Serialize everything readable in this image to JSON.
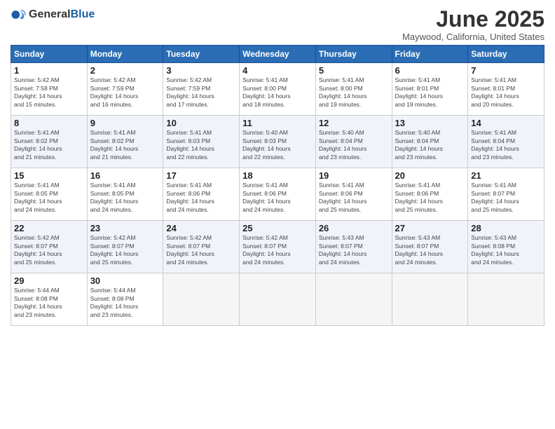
{
  "logo": {
    "general": "General",
    "blue": "Blue"
  },
  "title": "June 2025",
  "location": "Maywood, California, United States",
  "days_header": [
    "Sunday",
    "Monday",
    "Tuesday",
    "Wednesday",
    "Thursday",
    "Friday",
    "Saturday"
  ],
  "weeks": [
    [
      {
        "day": "1",
        "info": "Sunrise: 5:42 AM\nSunset: 7:58 PM\nDaylight: 14 hours\nand 15 minutes."
      },
      {
        "day": "2",
        "info": "Sunrise: 5:42 AM\nSunset: 7:59 PM\nDaylight: 14 hours\nand 16 minutes."
      },
      {
        "day": "3",
        "info": "Sunrise: 5:42 AM\nSunset: 7:59 PM\nDaylight: 14 hours\nand 17 minutes."
      },
      {
        "day": "4",
        "info": "Sunrise: 5:41 AM\nSunset: 8:00 PM\nDaylight: 14 hours\nand 18 minutes."
      },
      {
        "day": "5",
        "info": "Sunrise: 5:41 AM\nSunset: 8:00 PM\nDaylight: 14 hours\nand 19 minutes."
      },
      {
        "day": "6",
        "info": "Sunrise: 5:41 AM\nSunset: 8:01 PM\nDaylight: 14 hours\nand 19 minutes."
      },
      {
        "day": "7",
        "info": "Sunrise: 5:41 AM\nSunset: 8:01 PM\nDaylight: 14 hours\nand 20 minutes."
      }
    ],
    [
      {
        "day": "8",
        "info": "Sunrise: 5:41 AM\nSunset: 8:02 PM\nDaylight: 14 hours\nand 21 minutes."
      },
      {
        "day": "9",
        "info": "Sunrise: 5:41 AM\nSunset: 8:02 PM\nDaylight: 14 hours\nand 21 minutes."
      },
      {
        "day": "10",
        "info": "Sunrise: 5:41 AM\nSunset: 8:03 PM\nDaylight: 14 hours\nand 22 minutes."
      },
      {
        "day": "11",
        "info": "Sunrise: 5:40 AM\nSunset: 8:03 PM\nDaylight: 14 hours\nand 22 minutes."
      },
      {
        "day": "12",
        "info": "Sunrise: 5:40 AM\nSunset: 8:04 PM\nDaylight: 14 hours\nand 23 minutes."
      },
      {
        "day": "13",
        "info": "Sunrise: 5:40 AM\nSunset: 8:04 PM\nDaylight: 14 hours\nand 23 minutes."
      },
      {
        "day": "14",
        "info": "Sunrise: 5:41 AM\nSunset: 8:04 PM\nDaylight: 14 hours\nand 23 minutes."
      }
    ],
    [
      {
        "day": "15",
        "info": "Sunrise: 5:41 AM\nSunset: 8:05 PM\nDaylight: 14 hours\nand 24 minutes."
      },
      {
        "day": "16",
        "info": "Sunrise: 5:41 AM\nSunset: 8:05 PM\nDaylight: 14 hours\nand 24 minutes."
      },
      {
        "day": "17",
        "info": "Sunrise: 5:41 AM\nSunset: 8:06 PM\nDaylight: 14 hours\nand 24 minutes."
      },
      {
        "day": "18",
        "info": "Sunrise: 5:41 AM\nSunset: 8:06 PM\nDaylight: 14 hours\nand 24 minutes."
      },
      {
        "day": "19",
        "info": "Sunrise: 5:41 AM\nSunset: 8:06 PM\nDaylight: 14 hours\nand 25 minutes."
      },
      {
        "day": "20",
        "info": "Sunrise: 5:41 AM\nSunset: 8:06 PM\nDaylight: 14 hours\nand 25 minutes."
      },
      {
        "day": "21",
        "info": "Sunrise: 5:41 AM\nSunset: 8:07 PM\nDaylight: 14 hours\nand 25 minutes."
      }
    ],
    [
      {
        "day": "22",
        "info": "Sunrise: 5:42 AM\nSunset: 8:07 PM\nDaylight: 14 hours\nand 25 minutes."
      },
      {
        "day": "23",
        "info": "Sunrise: 5:42 AM\nSunset: 8:07 PM\nDaylight: 14 hours\nand 25 minutes."
      },
      {
        "day": "24",
        "info": "Sunrise: 5:42 AM\nSunset: 8:07 PM\nDaylight: 14 hours\nand 24 minutes."
      },
      {
        "day": "25",
        "info": "Sunrise: 5:42 AM\nSunset: 8:07 PM\nDaylight: 14 hours\nand 24 minutes."
      },
      {
        "day": "26",
        "info": "Sunrise: 5:43 AM\nSunset: 8:07 PM\nDaylight: 14 hours\nand 24 minutes."
      },
      {
        "day": "27",
        "info": "Sunrise: 5:43 AM\nSunset: 8:07 PM\nDaylight: 14 hours\nand 24 minutes."
      },
      {
        "day": "28",
        "info": "Sunrise: 5:43 AM\nSunset: 8:08 PM\nDaylight: 14 hours\nand 24 minutes."
      }
    ],
    [
      {
        "day": "29",
        "info": "Sunrise: 5:44 AM\nSunset: 8:08 PM\nDaylight: 14 hours\nand 23 minutes."
      },
      {
        "day": "30",
        "info": "Sunrise: 5:44 AM\nSunset: 8:08 PM\nDaylight: 14 hours\nand 23 minutes."
      },
      {
        "day": "",
        "info": ""
      },
      {
        "day": "",
        "info": ""
      },
      {
        "day": "",
        "info": ""
      },
      {
        "day": "",
        "info": ""
      },
      {
        "day": "",
        "info": ""
      }
    ]
  ]
}
